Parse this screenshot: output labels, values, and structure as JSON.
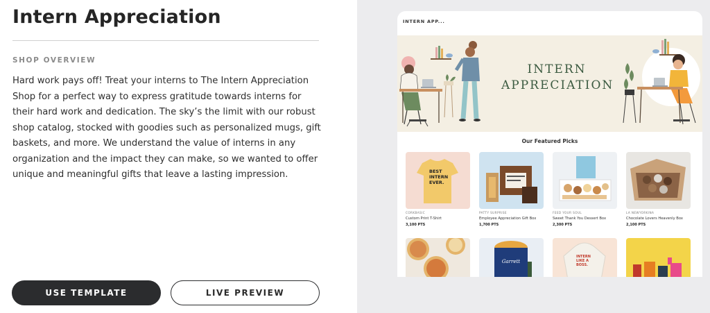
{
  "template": {
    "title": "Intern Appreciation",
    "section_label": "SHOP OVERVIEW",
    "description": "Hard work pays off! Treat your interns to The Intern Appreciation Shop for a perfect way to express gratitude towards interns for their hard work and dedication. The sky’s the limit with our robust shop catalog, stocked with goodies such as personalized mugs, gift baskets, and more. We understand the value of interns in any organization and the impact they can make, so we wanted to offer unique and meaningful gifts that leave a lasting impression."
  },
  "actions": {
    "use_template": "USE TEMPLATE",
    "live_preview": "LIVE PREVIEW"
  },
  "preview": {
    "shop_title": "INTERN APP...",
    "hero_line1": "INTERN",
    "hero_line2": "APPRECIATION",
    "featured_heading": "Our Featured Picks",
    "products": [
      {
        "vendor": "CORKBASIC",
        "name": "Custom Print T-Shirt",
        "points": "3,100 PTS",
        "shirt_text": "BEST INTERN EVER."
      },
      {
        "vendor": "PATTY SURPRISE",
        "name": "Employee Appreciation Gift Box",
        "points": "1,700 PTS"
      },
      {
        "vendor": "FEED YOUR SOUL",
        "name": "Sweet Thank You Dessert Box",
        "points": "2,300 PTS"
      },
      {
        "vendor": "LA NEWYORKINA",
        "name": "Chocolate Lovers Heavenly Box",
        "points": "2,100 PTS"
      }
    ],
    "second_row_labels": {
      "tin_label": "Garrett",
      "hoodie_text": "INTERN LIKE A BOSS."
    }
  },
  "colors": {
    "button_dark": "#2b2c2e",
    "hero_bg": "#f4efe3",
    "hero_text": "#3b5a40",
    "preview_bg": "#ececee"
  }
}
